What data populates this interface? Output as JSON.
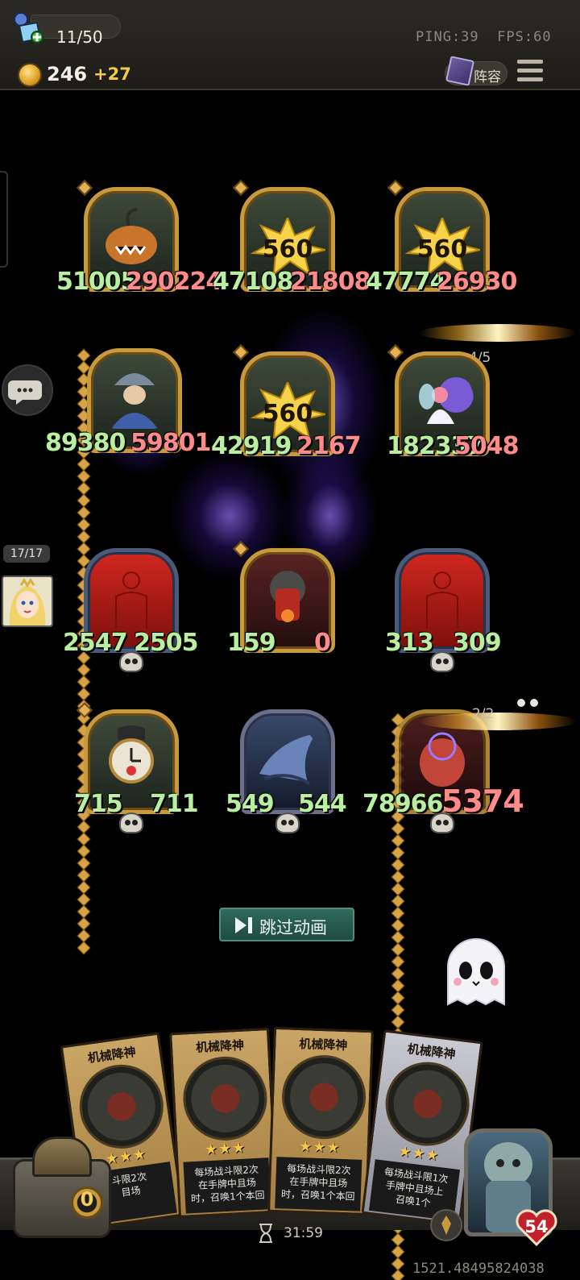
{
  "topbar": {
    "population": "11/50",
    "ping": "PING:39",
    "fps": "FPS:60",
    "coins": "246",
    "coins_gain": "+27",
    "lineup_label": "阵容"
  },
  "opponent": {
    "count": "17/17"
  },
  "board": {
    "row1": [
      {
        "atk": "51005",
        "hp": "290224"
      },
      {
        "atk": "47108",
        "hp": "21808",
        "burst": "560"
      },
      {
        "atk": "47774",
        "hp": "26930",
        "burst": "560"
      }
    ],
    "row1_counter": "4/5",
    "row2": [
      {
        "atk": "89380",
        "hp": "59801"
      },
      {
        "atk": "42919",
        "hp": "2167",
        "burst": "560"
      },
      {
        "atk": "182337",
        "hp": "5048"
      }
    ],
    "row3": [
      {
        "atk": "2547",
        "hp": "2505"
      },
      {
        "atk": "159",
        "hp": "0"
      },
      {
        "atk": "313",
        "hp": "309"
      }
    ],
    "row4": [
      {
        "atk": "715",
        "hp": "711"
      },
      {
        "atk": "549",
        "hp": "544"
      },
      {
        "atk": "78966",
        "hp": "5374"
      }
    ],
    "row4_counter": "2/2"
  },
  "skip_label": "跳过动画",
  "hand": [
    {
      "title": "机械降神",
      "desc": [
        "斗限2次",
        "目场"
      ]
    },
    {
      "title": "机械降神",
      "desc": [
        "每场战斗限2次",
        "在手牌中且场",
        "时，召唤1个本回"
      ]
    },
    {
      "title": "机械降神",
      "desc": [
        "每场战斗限2次",
        "在手牌中且场",
        "时，召唤1个本回"
      ]
    },
    {
      "title": "机械降神",
      "desc": [
        "每场战斗限1次",
        "手牌中且场上",
        "召唤1个"
      ]
    }
  ],
  "chest_count": "0",
  "timer": "31:59",
  "hero_hp": "54",
  "match_id": "1521.48495824038"
}
